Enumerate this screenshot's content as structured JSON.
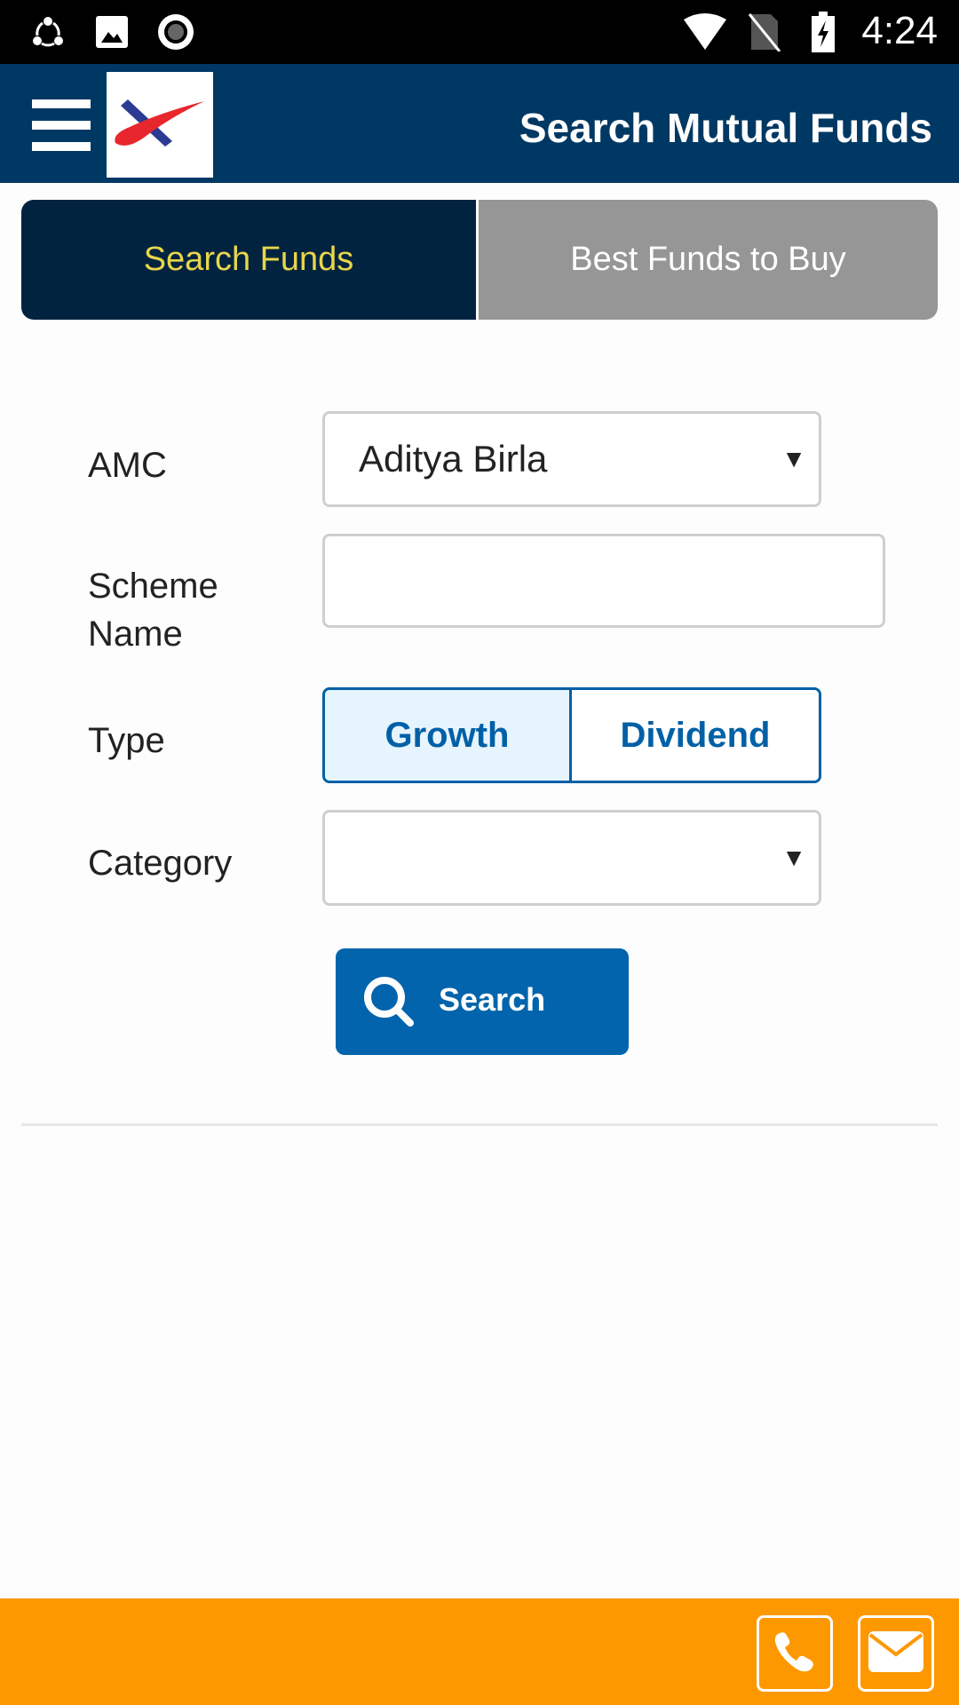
{
  "status_bar": {
    "time": "4:24",
    "left_icons": [
      "share-it-icon",
      "image-icon",
      "record-icon"
    ],
    "right_icons": [
      "wifi-icon",
      "no-sim-icon",
      "battery-charging-icon"
    ]
  },
  "app_bar": {
    "title": "Search Mutual Funds",
    "menu_icon": "hamburger-menu-icon",
    "logo": "brand-logo"
  },
  "tabs": [
    {
      "label": "Search Funds",
      "active": true
    },
    {
      "label": "Best Funds to Buy",
      "active": false
    }
  ],
  "form": {
    "amc": {
      "label": "AMC",
      "selected": "Aditya Birla"
    },
    "scheme_name": {
      "label_line1": "Scheme",
      "label_line2": "Name",
      "value": "",
      "placeholder": ""
    },
    "type": {
      "label": "Type",
      "options": [
        "Growth",
        "Dividend"
      ],
      "selected": "Growth"
    },
    "category": {
      "label": "Category",
      "selected": ""
    },
    "search_button": {
      "label": "Search",
      "icon": "search-icon"
    }
  },
  "footer": {
    "buttons": [
      {
        "icon": "phone-icon"
      },
      {
        "icon": "mail-icon"
      }
    ]
  },
  "colors": {
    "app_bar": "#003864",
    "tab_active_bg": "#012340",
    "tab_active_text": "#e8d64a",
    "tab_inactive_bg": "#969696",
    "primary_blue": "#0264ac",
    "footer": "#fd9800"
  }
}
